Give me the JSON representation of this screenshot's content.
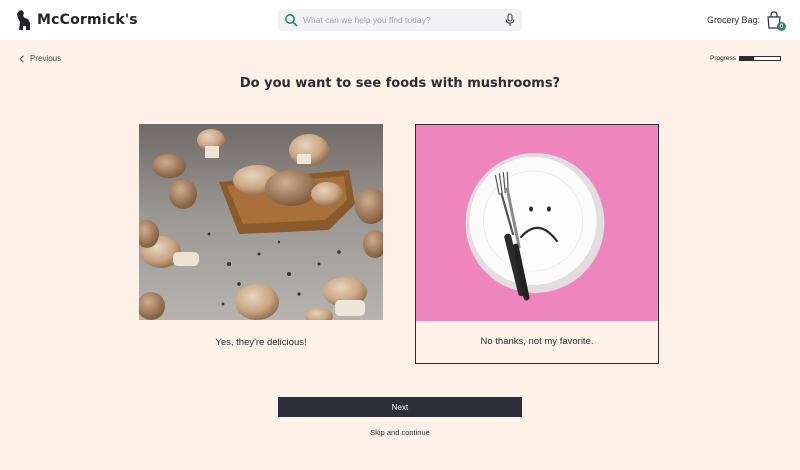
{
  "header": {
    "brand": "McCormick's",
    "search": {
      "placeholder": "What can we help you find today?",
      "value": ""
    },
    "bag": {
      "label": "Grocery Bag:",
      "count": "0"
    }
  },
  "nav": {
    "previous_label": "Previous",
    "progress_label": "Progress",
    "progress_fraction": 0.35
  },
  "question": "Do you want to see foods with mushrooms?",
  "options": [
    {
      "label": "Yes, they're delicious!",
      "image": "mushrooms-photo",
      "selected": false
    },
    {
      "label": "No thanks, not my favorite.",
      "image": "sad-plate-photo",
      "selected": true
    }
  ],
  "actions": {
    "next_label": "Next",
    "skip_label": "Skip and continue"
  },
  "colors": {
    "page_bg": "#fdf1e8",
    "button_bg": "#2d3038",
    "accent": "#2e8a6b",
    "pink_bg": "#ee86bd"
  }
}
